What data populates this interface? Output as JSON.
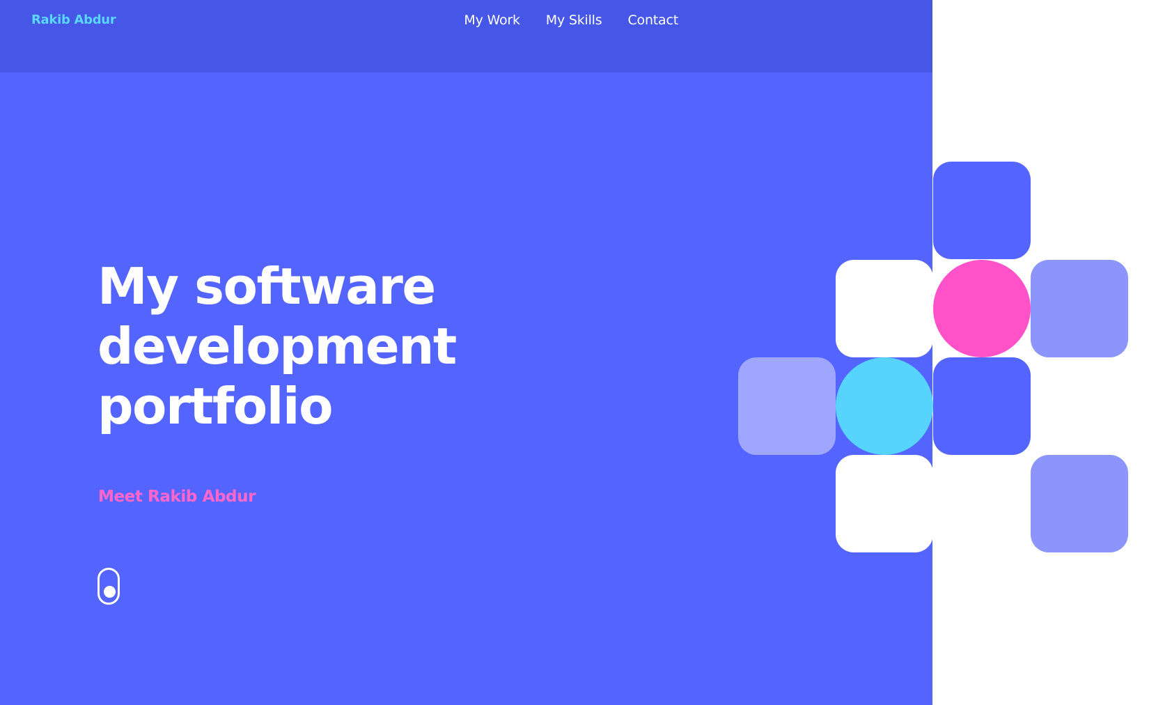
{
  "brand": {
    "name": "Rakib Abdur"
  },
  "nav": {
    "items": [
      {
        "label": "My Work"
      },
      {
        "label": "My Skills"
      },
      {
        "label": "Contact"
      }
    ]
  },
  "hero": {
    "headline_lines": [
      "My software",
      "development",
      "portfolio"
    ],
    "subtitle": "Meet Rakib Abdur"
  },
  "colors": {
    "hero_background": "#5465ff",
    "topbar_background": "#4657e8",
    "brand_text": "#59d7ff",
    "subtitle_text": "#ff66cc",
    "tile_blue": "#5465ff",
    "tile_white": "#ffffff",
    "tile_pink": "#ff52c9",
    "tile_lavender": "#8b95fb",
    "tile_light_lavender": "#9fa6fd",
    "tile_cyan": "#56d4fd"
  },
  "decor": {
    "tile_grid": [
      {
        "shape": "square",
        "color": "tile_blue"
      },
      {
        "shape": "square",
        "color": "tile_white"
      },
      {
        "shape": "circle",
        "color": "tile_pink"
      },
      {
        "shape": "square",
        "color": "tile_lavender"
      },
      {
        "shape": "square",
        "color": "tile_light_lavender"
      },
      {
        "shape": "circle",
        "color": "tile_cyan"
      },
      {
        "shape": "square",
        "color": "tile_blue"
      },
      {
        "shape": "square",
        "color": "tile_white"
      },
      {
        "shape": "square",
        "color": "tile_lavender"
      }
    ]
  },
  "icons": {
    "scroll": "mouse-scroll-icon"
  }
}
